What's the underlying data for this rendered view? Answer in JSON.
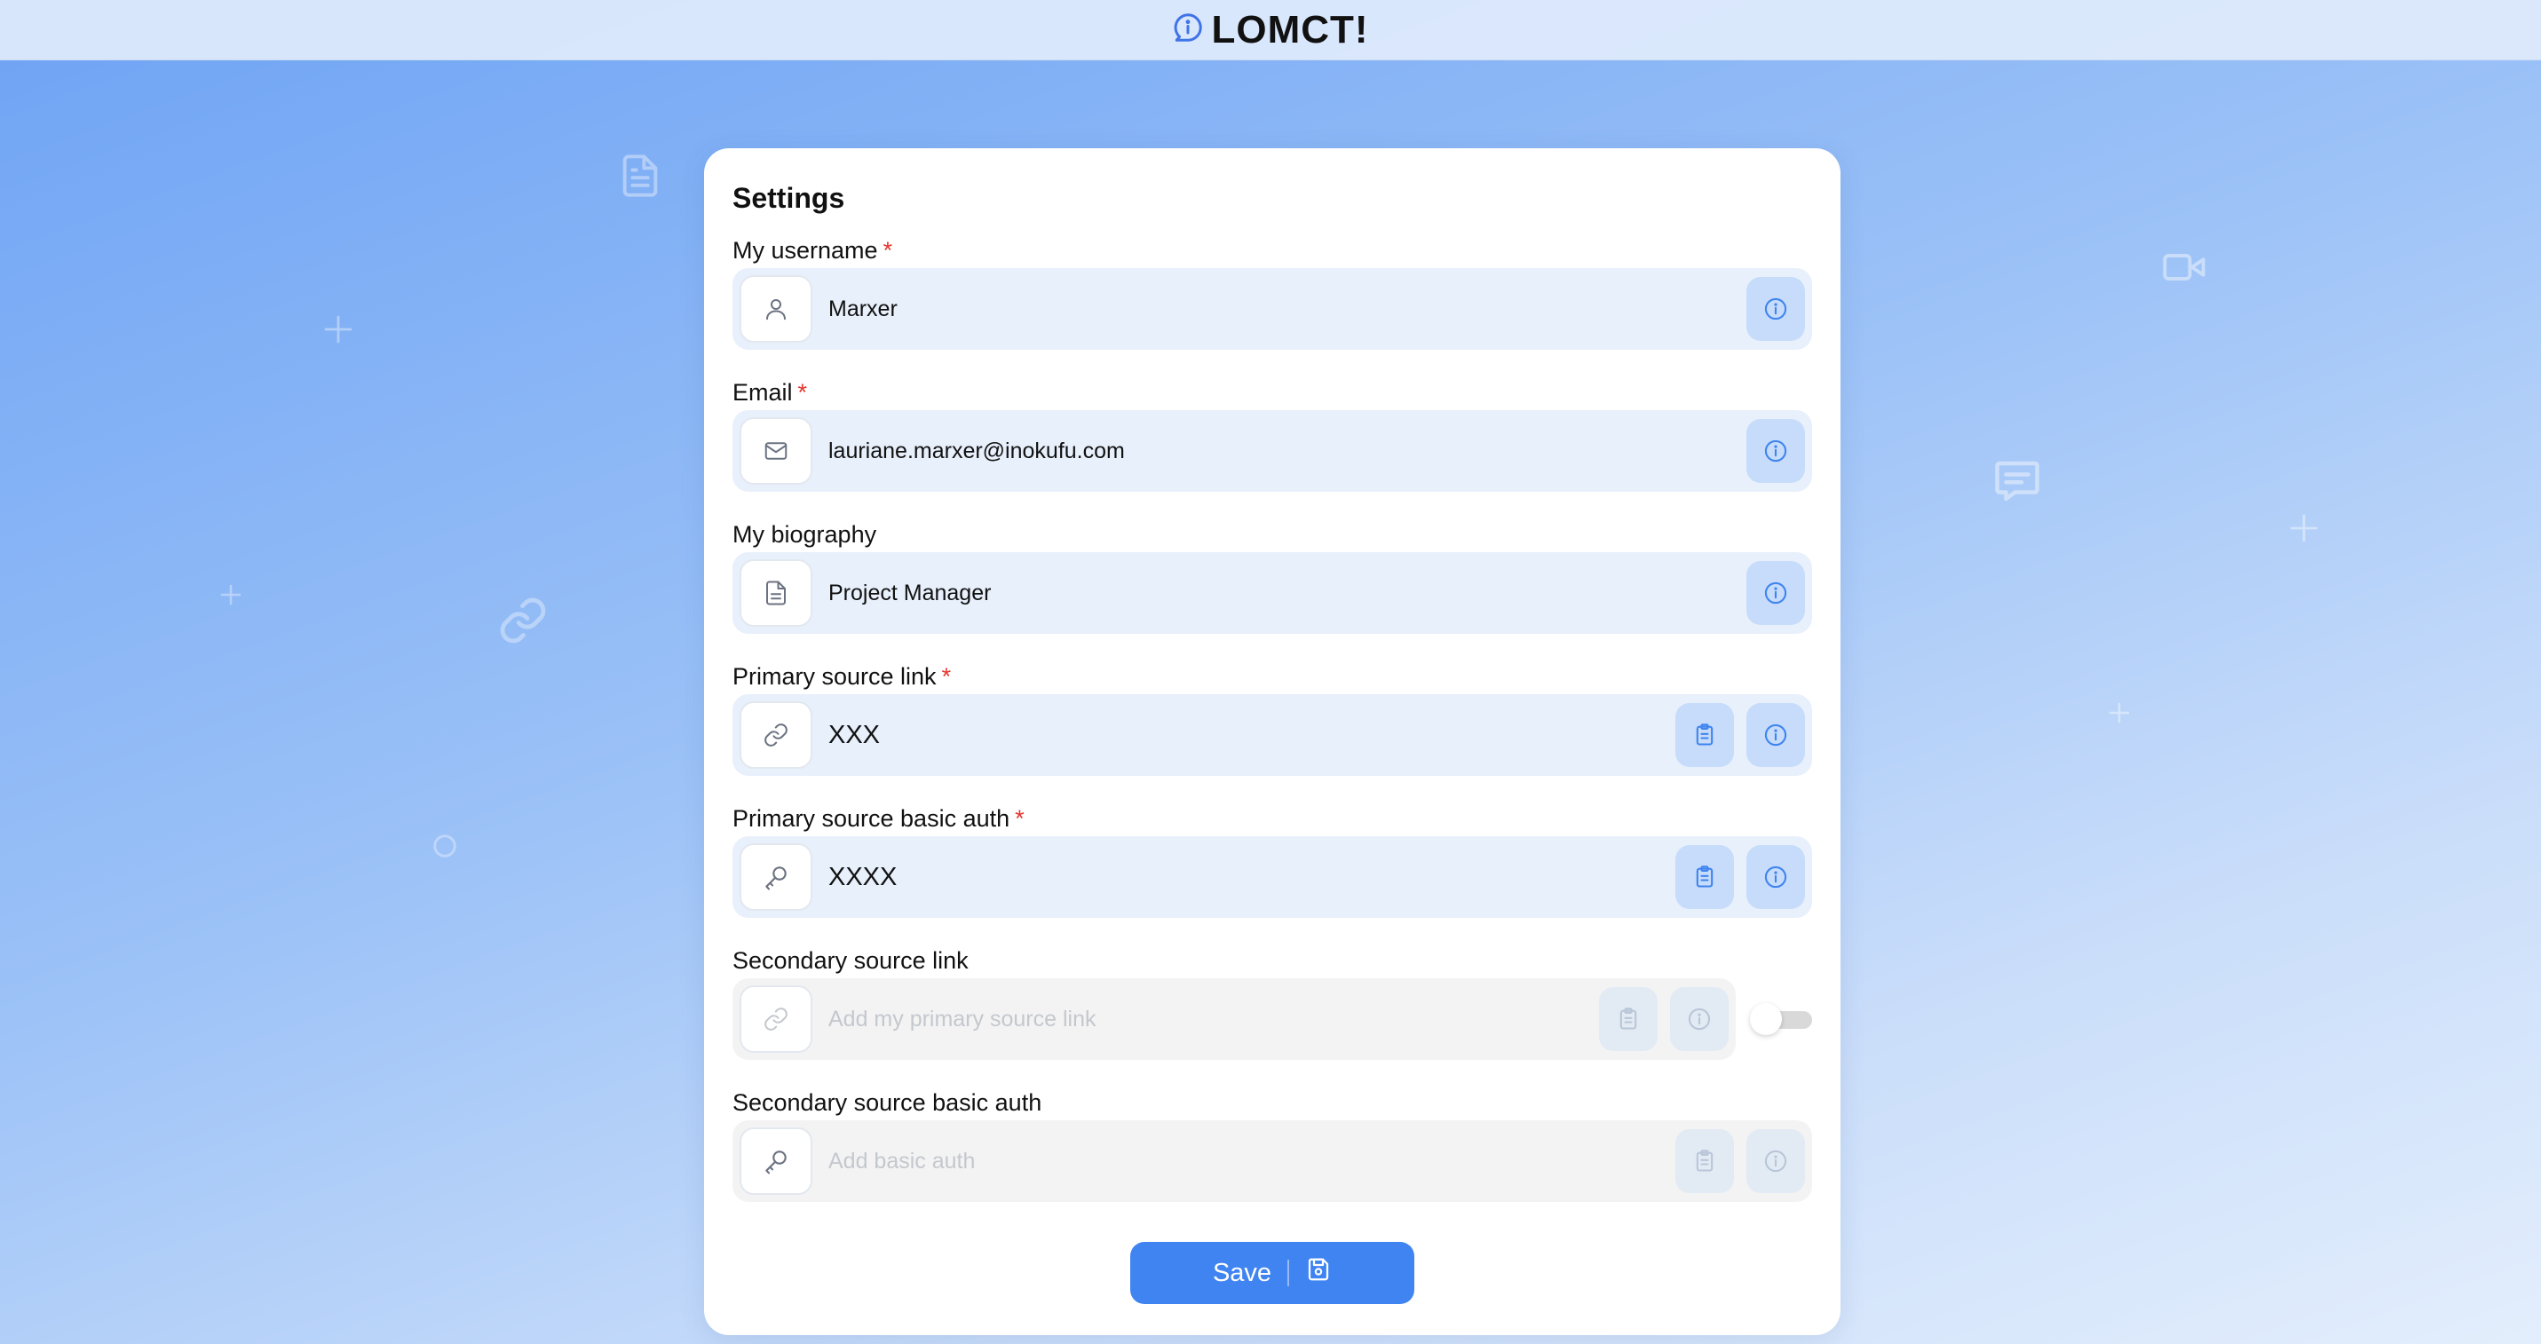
{
  "app": {
    "name": "LOMCT!"
  },
  "page": {
    "title": "Settings"
  },
  "fields": [
    {
      "label": "My username",
      "required": true,
      "value": "Marxer",
      "placeholder": "",
      "icon": "user-icon",
      "actions": [
        "info"
      ],
      "disabled": false
    },
    {
      "label": "Email",
      "required": true,
      "value": "lauriane.marxer@inokufu.com",
      "placeholder": "",
      "icon": "mail-icon",
      "actions": [
        "info"
      ],
      "disabled": false
    },
    {
      "label": "My biography",
      "required": false,
      "value": "Project Manager",
      "placeholder": "",
      "icon": "document-icon",
      "actions": [
        "info"
      ],
      "disabled": false
    },
    {
      "label": "Primary source link",
      "required": true,
      "value": "XXX",
      "placeholder": "",
      "icon": "link-icon",
      "actions": [
        "clipboard",
        "info"
      ],
      "disabled": false
    },
    {
      "label": "Primary source basic auth",
      "required": true,
      "value": "XXXX",
      "placeholder": "",
      "icon": "key-icon",
      "actions": [
        "clipboard",
        "info"
      ],
      "disabled": false
    },
    {
      "label": "Secondary source link",
      "required": false,
      "value": "",
      "placeholder": "Add my primary source link",
      "icon": "link-icon",
      "actions": [
        "clipboard",
        "info"
      ],
      "disabled": true,
      "toggle": "off"
    },
    {
      "label": "Secondary source basic auth",
      "required": false,
      "value": "",
      "placeholder": "Add basic auth",
      "icon": "key-icon",
      "actions": [
        "clipboard",
        "info"
      ],
      "disabled": true
    }
  ],
  "required_marker": "*",
  "save": {
    "label": "Save",
    "icon": "save-icon"
  },
  "colors": {
    "accent": "#3f84f0",
    "required": "#e5342e",
    "input_bg": "#e8f0fc",
    "disabled_bg": "#f3f3f3"
  }
}
